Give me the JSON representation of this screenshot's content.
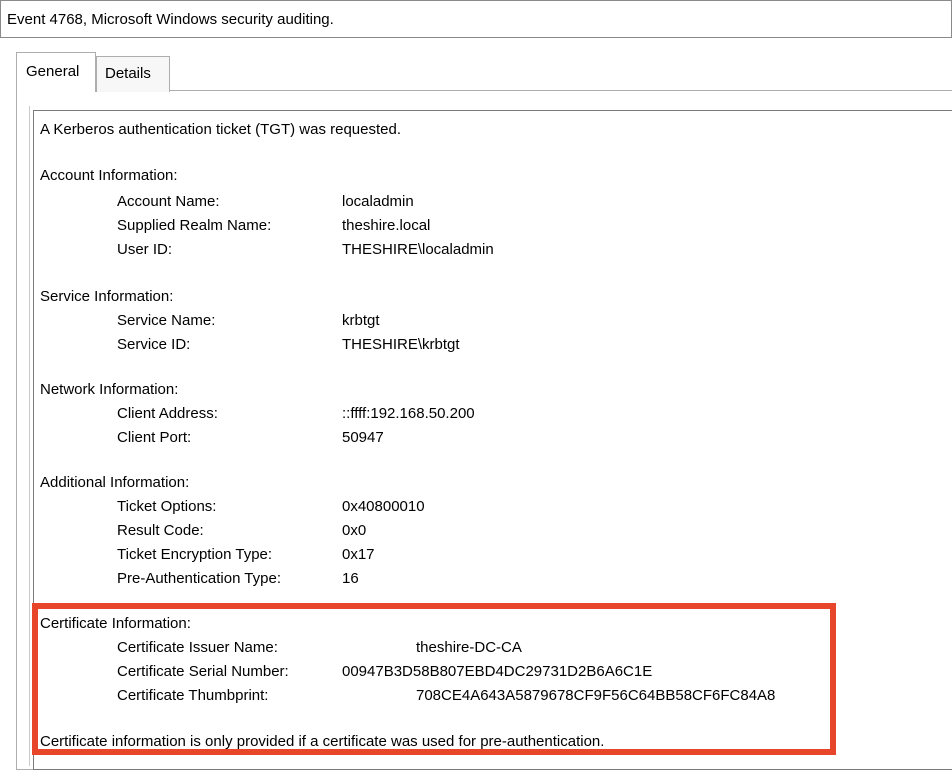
{
  "window": {
    "title": "Event 4768, Microsoft Windows security auditing."
  },
  "tabs": [
    {
      "label": "General"
    },
    {
      "label": "Details"
    }
  ],
  "event": {
    "headline": "A Kerberos authentication ticket (TGT) was requested.",
    "account": {
      "heading": "Account Information:",
      "account_name_label": "Account Name:",
      "account_name": "localadmin",
      "realm_label": "Supplied Realm Name:",
      "realm": "theshire.local",
      "user_id_label": "User ID:",
      "user_id": "THESHIRE\\localadmin"
    },
    "service": {
      "heading": "Service Information:",
      "service_name_label": "Service Name:",
      "service_name": "krbtgt",
      "service_id_label": "Service ID:",
      "service_id": "THESHIRE\\krbtgt"
    },
    "network": {
      "heading": "Network Information:",
      "client_address_label": "Client Address:",
      "client_address": "::ffff:192.168.50.200",
      "client_port_label": "Client Port:",
      "client_port": "50947"
    },
    "additional": {
      "heading": "Additional Information:",
      "ticket_options_label": "Ticket Options:",
      "ticket_options": "0x40800010",
      "result_code_label": "Result Code:",
      "result_code": "0x0",
      "encryption_label": "Ticket Encryption Type:",
      "encryption": "0x17",
      "preauth_label": "Pre-Authentication Type:",
      "preauth": "16"
    },
    "certificate": {
      "heading": "Certificate Information:",
      "issuer_label": "Certificate Issuer Name:",
      "issuer": "theshire-DC-CA",
      "serial_label": "Certificate Serial Number:",
      "serial": "00947B3D58B807EBD4DC29731D2B6A6C1E",
      "thumbprint_label": "Certificate Thumbprint:",
      "thumbprint": "708CE4A643A5879678CF9F56C64BB58CF6FC84A8",
      "note": "Certificate information is only provided if a certificate was used for pre-authentication."
    }
  },
  "highlight_color": "#e8462a"
}
